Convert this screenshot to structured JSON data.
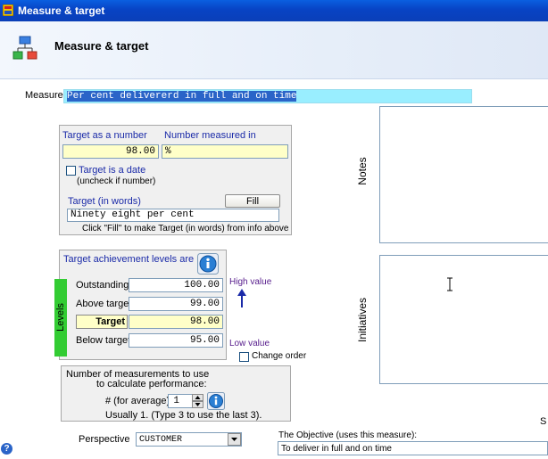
{
  "window": {
    "title": "Measure & target"
  },
  "header": {
    "title": "Measure & target"
  },
  "measure": {
    "label": "Measure",
    "value": "Per cent delivererd in full and on time"
  },
  "target": {
    "number_label": "Target as a number",
    "measured_in_label": "Number measured in",
    "number_value": "98.00",
    "measured_in_value": "%",
    "is_date_label": "Target is a date",
    "uncheck_note": "(uncheck if number)",
    "words_label": "Target (in words)",
    "fill_label": "Fill",
    "words_value": "Ninety eight per cent",
    "fill_hint": "Click \"Fill\" to make Target (in words) from info above"
  },
  "levels": {
    "heading": "Target achievement levels are",
    "side_label": "Levels",
    "rows": [
      {
        "label": "Outstanding",
        "value": "100.00"
      },
      {
        "label": "Above target",
        "value": "99.00"
      },
      {
        "label": "Target",
        "value": "98.00"
      },
      {
        "label": "Below target",
        "value": "95.00"
      }
    ],
    "high_value": "High value",
    "low_value": "Low value",
    "change_order": "Change order"
  },
  "measurements": {
    "line1": "Number of measurements to use",
    "line2": "to calculate performance:",
    "avg_label": "# (for average)",
    "avg_value": "1",
    "usually": "Usually 1. (Type 3 to use the last 3)."
  },
  "perspective": {
    "label": "Perspective",
    "value": "CUSTOMER"
  },
  "objective": {
    "label": "The Objective (uses this measure):",
    "value": "To deliver in full and on time"
  },
  "notes": {
    "label": "Notes"
  },
  "initiatives": {
    "label": "Initiatives"
  },
  "cut_letter": "S",
  "help": {
    "glyph": "?"
  },
  "colors": {
    "accent": "#1a2aa8",
    "highlight": "#99eeff",
    "levels_tab": "#33cc33",
    "yellow_field": "#ffffc8"
  }
}
